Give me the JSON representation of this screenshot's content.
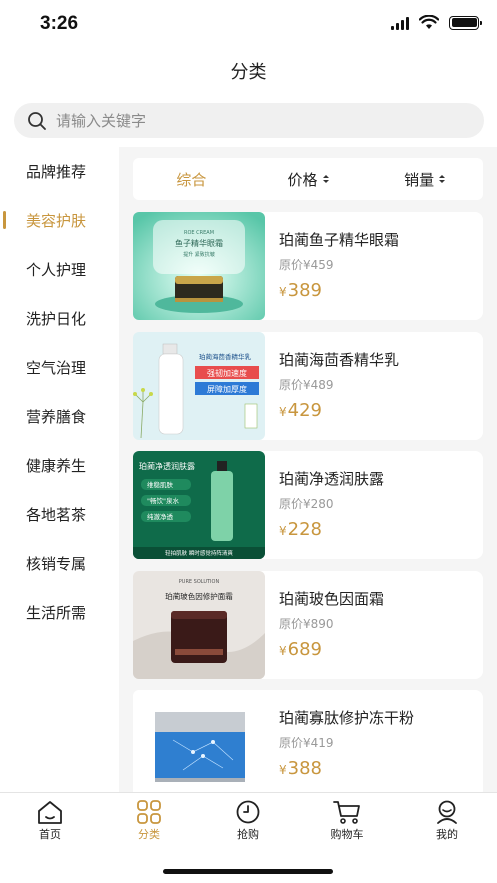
{
  "status_bar": {
    "time": "3:26"
  },
  "header": {
    "title": "分类"
  },
  "search": {
    "placeholder": "请输入关键字"
  },
  "sidebar": {
    "active_index": 1,
    "items": [
      {
        "label": "品牌推荐"
      },
      {
        "label": "美容护肤"
      },
      {
        "label": "个人护理"
      },
      {
        "label": "洗护日化"
      },
      {
        "label": "空气治理"
      },
      {
        "label": "营养膳食"
      },
      {
        "label": "健康养生"
      },
      {
        "label": "各地茗茶"
      },
      {
        "label": "核销专属"
      },
      {
        "label": "生活所需"
      }
    ]
  },
  "sort_bar": {
    "comprehensive": "综合",
    "price": "价格",
    "sales": "销量"
  },
  "currency_symbol": "¥",
  "products": [
    {
      "name": "珀蔺鱼子精华眼霜",
      "original": "原价¥459",
      "price": "389",
      "image_text": [
        "鱼子精华眼霜",
        "ROE CREAM",
        "提升 紧致抗皱"
      ]
    },
    {
      "name": "珀蔺海茴香精华乳",
      "original": "原价¥489",
      "price": "429",
      "image_text": [
        "珀蔺海茴香精华乳",
        "强韧加速度",
        "屏障加厚度"
      ]
    },
    {
      "name": "珀蔺净透润肤露",
      "original": "原价¥280",
      "price": "228",
      "image_text": [
        "珀蔺净透润肤露",
        "维稳肌肤",
        "\"畅饮\"泉水",
        "纯澈净透",
        "轻拍肌肤 瞬时感觉持阵清爽"
      ]
    },
    {
      "name": "珀蔺玻色因面霜",
      "original": "原价¥890",
      "price": "689",
      "image_text": [
        "PURE SOLUTION",
        "珀蔺玻色因修护面霜"
      ]
    },
    {
      "name": "珀蔺寡肽修护冻干粉",
      "original": "原价¥419",
      "price": "388",
      "image_text": []
    }
  ],
  "tab_bar": {
    "active_index": 1,
    "tabs": [
      {
        "label": "首页",
        "icon": "home-icon"
      },
      {
        "label": "分类",
        "icon": "category-icon"
      },
      {
        "label": "抢购",
        "icon": "clock-icon"
      },
      {
        "label": "购物车",
        "icon": "cart-icon"
      },
      {
        "label": "我的",
        "icon": "user-icon"
      }
    ]
  },
  "colors": {
    "accent": "#c8963e",
    "background": "#f5f5f5",
    "text": "#222222",
    "muted": "#999999"
  }
}
